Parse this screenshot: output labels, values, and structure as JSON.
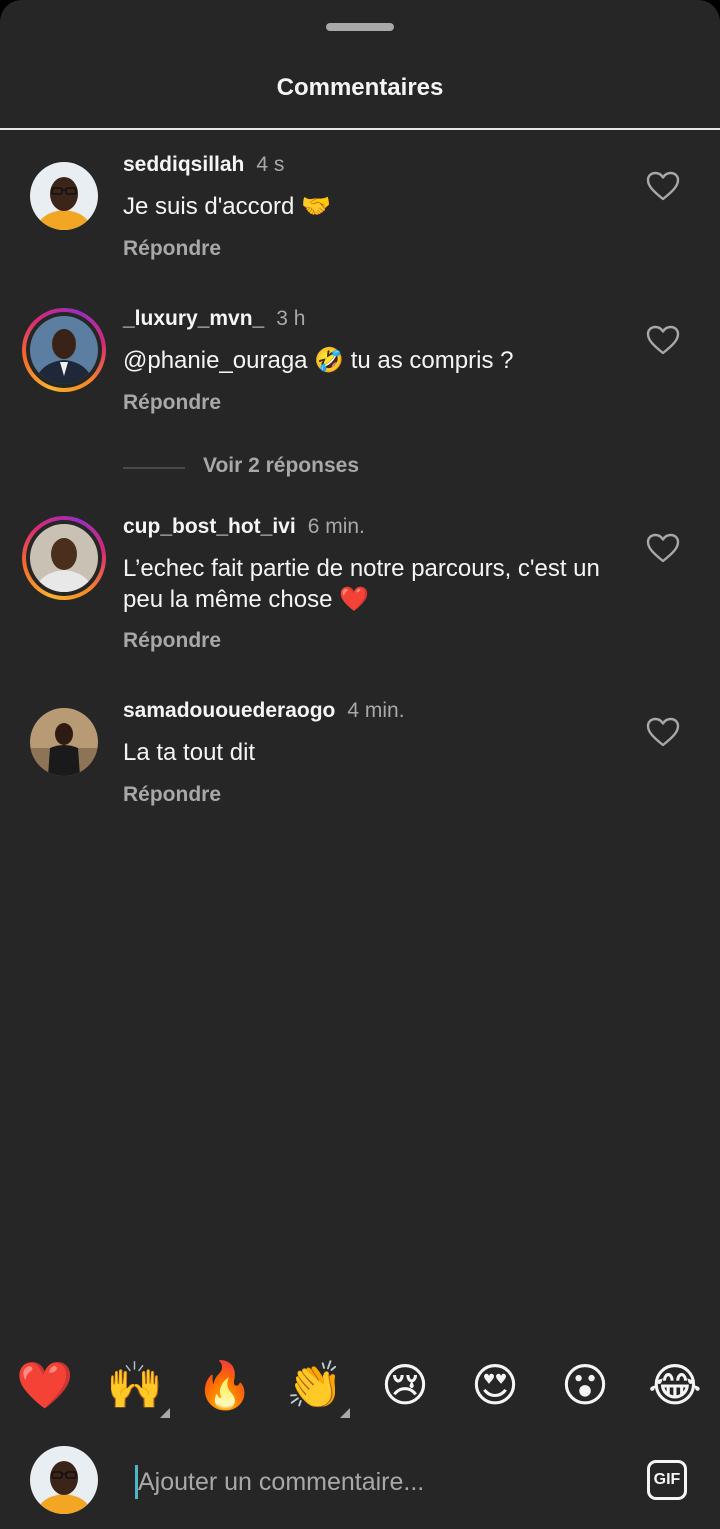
{
  "sheet": {
    "title": "Commentaires"
  },
  "comments": [
    {
      "username": "seddiqsillah",
      "time": "4 s",
      "text": "Je suis d'accord 🤝",
      "reply_label": "Répondre",
      "has_story_ring": false,
      "like_icon": "heart-outline-icon"
    },
    {
      "username": "_luxury_mvn_",
      "time": "3 h",
      "text": "@phanie_ouraga 🤣 tu as compris ?",
      "reply_label": "Répondre",
      "has_story_ring": true,
      "like_icon": "heart-outline-icon"
    },
    {
      "username": "cup_bost_hot_ivi",
      "time": "6 min.",
      "text": "L’echec fait partie de notre parcours, c'est un peu la même chose ❤️",
      "reply_label": "Répondre",
      "has_story_ring": true,
      "like_icon": "heart-outline-icon"
    },
    {
      "username": "samadououederaogo",
      "time": "4 min.",
      "text": "La ta tout dit",
      "reply_label": "Répondre",
      "has_story_ring": false,
      "like_icon": "heart-outline-icon"
    }
  ],
  "view_replies": {
    "label": "Voir 2 réponses"
  },
  "emoji_bar": [
    {
      "emoji": "❤️",
      "has_variants": false
    },
    {
      "emoji": "🙌",
      "has_variants": true
    },
    {
      "emoji": "🔥",
      "has_variants": false
    },
    {
      "emoji": "👏",
      "has_variants": true
    },
    {
      "emoji": "😢",
      "has_variants": false
    },
    {
      "emoji": "😍",
      "has_variants": false
    },
    {
      "emoji": "😮",
      "has_variants": false
    },
    {
      "emoji": "😂",
      "has_variants": false
    }
  ],
  "composer": {
    "placeholder": "Ajouter un commentaire...",
    "gif_label": "GIF"
  },
  "colors": {
    "background": "#262626",
    "text_primary": "#f5f5f5",
    "text_secondary": "#a8a8a8",
    "caret": "#4fb6c6"
  }
}
